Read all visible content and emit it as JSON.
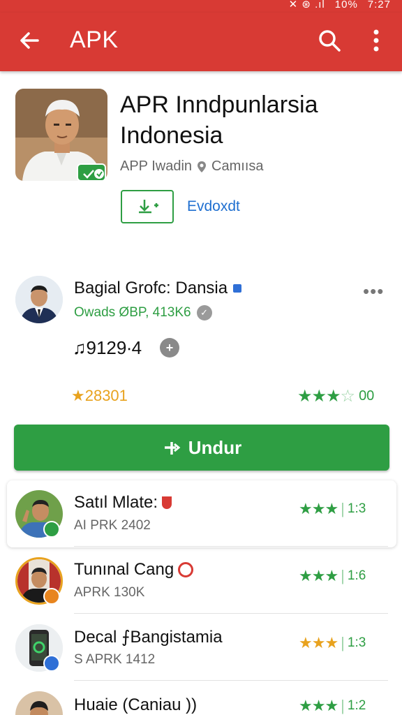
{
  "status_bar": {
    "icons_text": "✕  ⊛  .ıl",
    "battery": "10%",
    "time": "7:27"
  },
  "appbar": {
    "title": "APK",
    "bg_color": "#d83a34"
  },
  "hero": {
    "title": "APR Inndpunlarsia Indonesia",
    "subtitle_left": "APP Iwadin",
    "subtitle_right": "Camıısa",
    "install_label": "Evdoxdt"
  },
  "developer": {
    "name": "Bagial Grofc: Dansia",
    "sub": "Owads ØBP, 413K6",
    "stat": "♫9129∙4",
    "stat_icon": "+",
    "rating_left": "★28301",
    "rating_right_stars": "★★★",
    "rating_right_num": "00"
  },
  "download_button": {
    "label": "Undur",
    "color": "#2e9e43"
  },
  "list": [
    {
      "name": "Satıl Mlate:",
      "sub": "AI PRK 2402",
      "stars": "★★★",
      "num": "1:3",
      "star_color": "#2e9e43",
      "badge_color": "#2e9e43"
    },
    {
      "name": "Tunınal Cang",
      "sub": "APRK 130K",
      "stars": "★★★",
      "num": "1:6",
      "star_color": "#2e9e43",
      "badge_color": "#e8851e"
    },
    {
      "name": "Decal ⨍Bangistamia",
      "sub": "S APRK 1412",
      "stars": "★★★",
      "num": "1:3",
      "star_color": "#e8a21e",
      "badge_color": "#2f6fd6"
    },
    {
      "name": "Huaie (Caniau ))",
      "sub": "",
      "stars": "★★★",
      "num": "1:2",
      "star_color": "#2e9e43",
      "badge_color": "#2e9e43"
    }
  ]
}
